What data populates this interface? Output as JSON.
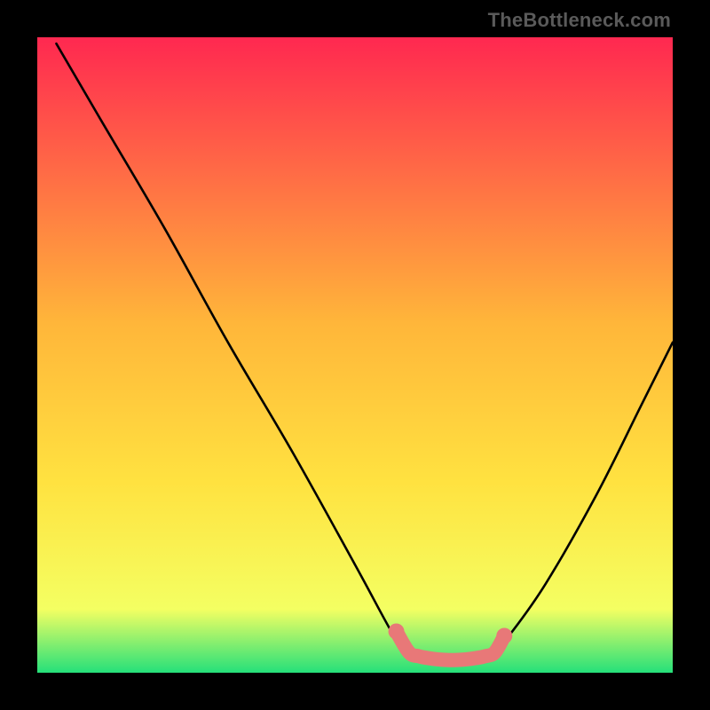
{
  "watermark": "TheBottleneck.com",
  "chart_data": {
    "type": "line",
    "title": "",
    "xlabel": "",
    "ylabel": "",
    "xlim": [
      0,
      100
    ],
    "ylim": [
      0,
      100
    ],
    "background_gradient": {
      "top": "#ff2850",
      "mid1": "#ffb63a",
      "mid2": "#ffe240",
      "mid3": "#f4ff62",
      "bottom": "#25e07a"
    },
    "series": [
      {
        "name": "bottleneck-curve-left",
        "color": "#000000",
        "x": [
          3,
          10,
          20,
          30,
          40,
          50,
          56
        ],
        "y": [
          99,
          87,
          70,
          52,
          35,
          17,
          6
        ]
      },
      {
        "name": "bottleneck-valley",
        "color": "#000000",
        "x": [
          56,
          58,
          60,
          63,
          66,
          69,
          72,
          74
        ],
        "y": [
          6,
          3.5,
          2.4,
          2.0,
          2.0,
          2.3,
          3.2,
          5.5
        ]
      },
      {
        "name": "bottleneck-curve-right",
        "color": "#000000",
        "x": [
          74,
          80,
          88,
          95,
          100
        ],
        "y": [
          5.5,
          14,
          28,
          42,
          52
        ]
      },
      {
        "name": "bottleneck-markers",
        "color": "#e87878",
        "type": "scatter",
        "x": [
          56.5,
          58.5,
          60,
          61.5,
          63,
          64.5,
          66,
          67.5,
          69,
          70.5,
          72,
          73.5
        ],
        "y": [
          6.5,
          3.2,
          2.6,
          2.3,
          2.1,
          2.0,
          2.0,
          2.1,
          2.3,
          2.6,
          3.2,
          5.8
        ]
      }
    ]
  }
}
